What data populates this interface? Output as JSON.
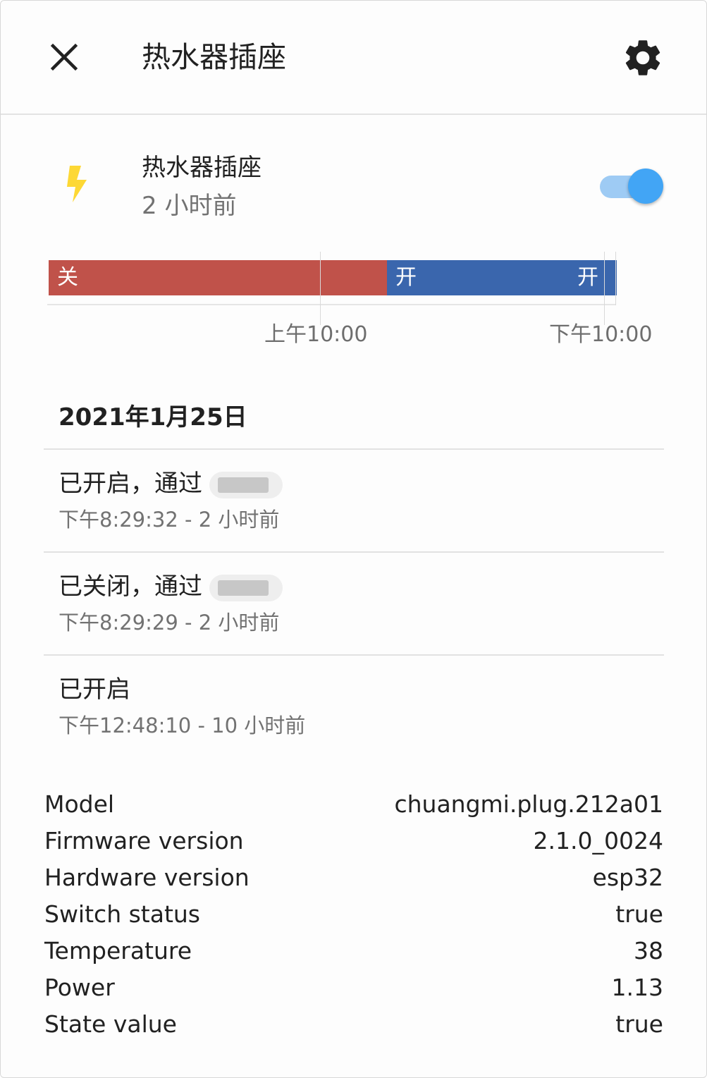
{
  "header": {
    "title": "热水器插座",
    "close_icon": "close-icon",
    "settings_icon": "gear-icon"
  },
  "entity": {
    "icon": "flash-icon",
    "icon_color": "#fdd835",
    "name": "热水器插座",
    "last_changed": "2 小时前",
    "toggle_on": true,
    "toggle_color": "#42a5f5"
  },
  "timeline": {
    "segments": [
      {
        "label": "关",
        "state": "off",
        "color": "#c0524a"
      },
      {
        "label": "开",
        "state": "on",
        "color": "#3a66ad"
      },
      {
        "label": "开",
        "state": "on",
        "color": "#3a66ad"
      }
    ],
    "ticks": [
      "上午10:00",
      "下午10:00"
    ]
  },
  "logbook": {
    "date": "2021年1月25日",
    "entries": [
      {
        "message": "已开启，通过",
        "time": "下午8:29:32 - 2 小时前",
        "has_redacted_actor": true
      },
      {
        "message": "已关闭，通过",
        "time": "下午8:29:29 - 2 小时前",
        "has_redacted_actor": true
      },
      {
        "message": "已开启",
        "time": "下午12:48:10 - 10 小时前",
        "has_redacted_actor": false
      }
    ]
  },
  "attributes": [
    {
      "key": "Model",
      "value": "chuangmi.plug.212a01"
    },
    {
      "key": "Firmware version",
      "value": "2.1.0_0024"
    },
    {
      "key": "Hardware version",
      "value": "esp32"
    },
    {
      "key": "Switch status",
      "value": "true"
    },
    {
      "key": "Temperature",
      "value": "38"
    },
    {
      "key": "Power",
      "value": "1.13"
    },
    {
      "key": "State value",
      "value": "true"
    }
  ]
}
